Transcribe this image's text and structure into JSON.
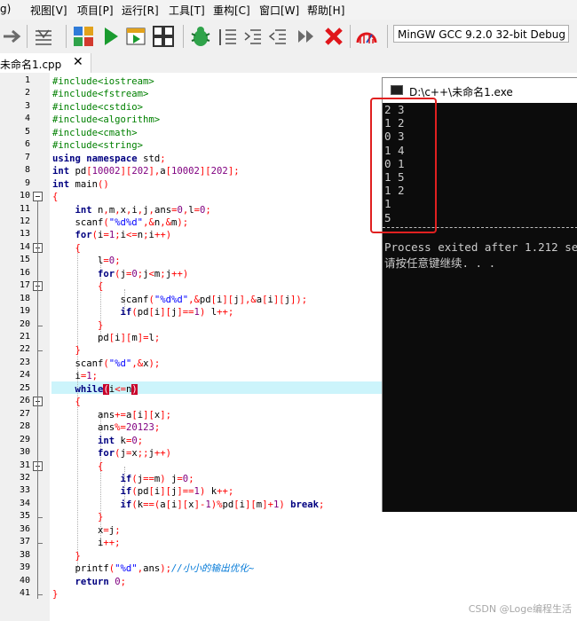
{
  "menu": [
    "g)",
    "视图[V]",
    "项目[P]",
    "运行[R]",
    "工具[T]",
    "重构[C]",
    "窗口[W]",
    "帮助[H]"
  ],
  "toolbar": {
    "compiler": "MinGW GCC 9.2.0 32-bit Debug",
    "icons": [
      "arrow-right-icon",
      "indent-icon",
      "layout-icon",
      "run-icon",
      "compile-run-icon",
      "grid-icon",
      "debug-icon",
      "list-icon",
      "indent-more-icon",
      "indent-less-icon",
      "step-forward-icon",
      "stop-icon",
      "profile-icon"
    ]
  },
  "tab": {
    "label": "未命名1.cpp",
    "close": "✕"
  },
  "editor": {
    "line_numbers": [
      "1",
      "2",
      "3",
      "4",
      "5",
      "6",
      "7",
      "8",
      "9",
      "10",
      "11",
      "12",
      "13",
      "14",
      "15",
      "16",
      "17",
      "18",
      "19",
      "20",
      "21",
      "22",
      "23",
      "24",
      "25",
      "26",
      "27",
      "28",
      "29",
      "30",
      "31",
      "32",
      "33",
      "34",
      "35",
      "36",
      "37",
      "38",
      "39",
      "40",
      "41"
    ],
    "current_line": 25,
    "colors": {
      "keyword": "#000080",
      "preprocessor": "#008000",
      "string": "#0000ff",
      "number": "#800080",
      "operator": "#ff0000",
      "comment": "#0078d7",
      "highlight": "#ccf4fb"
    }
  },
  "console": {
    "title": "D:\\c++\\未命名1.exe",
    "output": [
      "2 3",
      "1 2",
      "0 3",
      "1 4",
      "0 1",
      "1 5",
      "1 2",
      "1",
      "5"
    ],
    "exit_msg": "Process exited after 1.212 se",
    "prompt": "请按任意键继续. . ."
  },
  "watermark": "CSDN @Loge编程生活"
}
